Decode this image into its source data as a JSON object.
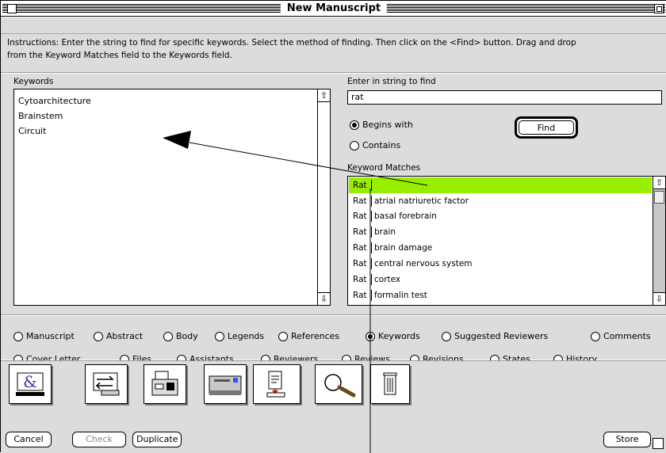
{
  "window": {
    "title": "New Manuscript"
  },
  "instructions": {
    "line1": "Instructions: Enter the string to find for specific keywords. Select the method of finding. Then click on the <Find> button. Drag and drop",
    "line2": "from the Keyword Matches field to the Keywords field."
  },
  "keywords": {
    "label": "Keywords",
    "items": [
      "Cytoarchitecture",
      "Brainstem",
      "Circuit"
    ]
  },
  "search": {
    "label": "Enter in string to find",
    "value": "rat",
    "options": [
      {
        "label": "Begins with",
        "selected": true
      },
      {
        "label": "Contains",
        "selected": false
      }
    ],
    "find_label": "Find"
  },
  "matches": {
    "label": "Keyword Matches",
    "selected_color": "#99ee00",
    "items": [
      {
        "head": "Rat",
        "tail": ""
      },
      {
        "head": "Rat",
        "tail": "atrial natriuretic factor"
      },
      {
        "head": "Rat",
        "tail": "basal forebrain"
      },
      {
        "head": "Rat",
        "tail": "brain"
      },
      {
        "head": "Rat",
        "tail": "brain damage"
      },
      {
        "head": "Rat",
        "tail": "central nervous system"
      },
      {
        "head": "Rat",
        "tail": "cortex"
      },
      {
        "head": "Rat",
        "tail": "formalin test"
      }
    ]
  },
  "sections_row1": [
    {
      "label": "Manuscript",
      "selected": false
    },
    {
      "label": "Abstract",
      "selected": false
    },
    {
      "label": "Body",
      "selected": false
    },
    {
      "label": "Legends",
      "selected": false
    },
    {
      "label": "References",
      "selected": false
    },
    {
      "label": "Keywords",
      "selected": true
    },
    {
      "label": "Suggested Reviewers",
      "selected": false
    },
    {
      "label": "Comments",
      "selected": false
    }
  ],
  "sections_row2": [
    {
      "label": "Cover Letter",
      "selected": false
    },
    {
      "label": "Files",
      "selected": false
    },
    {
      "label": "Assistants",
      "selected": false
    },
    {
      "label": "Reviewers",
      "selected": false
    },
    {
      "label": "Reviews",
      "selected": false
    },
    {
      "label": "Revisions",
      "selected": false
    },
    {
      "label": "States",
      "selected": false
    },
    {
      "label": "History",
      "selected": false
    }
  ],
  "toolbar": {
    "icons": [
      "ampersand-icon",
      "transfer-icon",
      "print-fax-icon",
      "mail-icon",
      "document-icon",
      "magnifier-icon",
      "trash-icon"
    ]
  },
  "buttons": {
    "cancel": "Cancel",
    "check": "Check",
    "duplicate": "Duplicate",
    "store": "Store"
  }
}
